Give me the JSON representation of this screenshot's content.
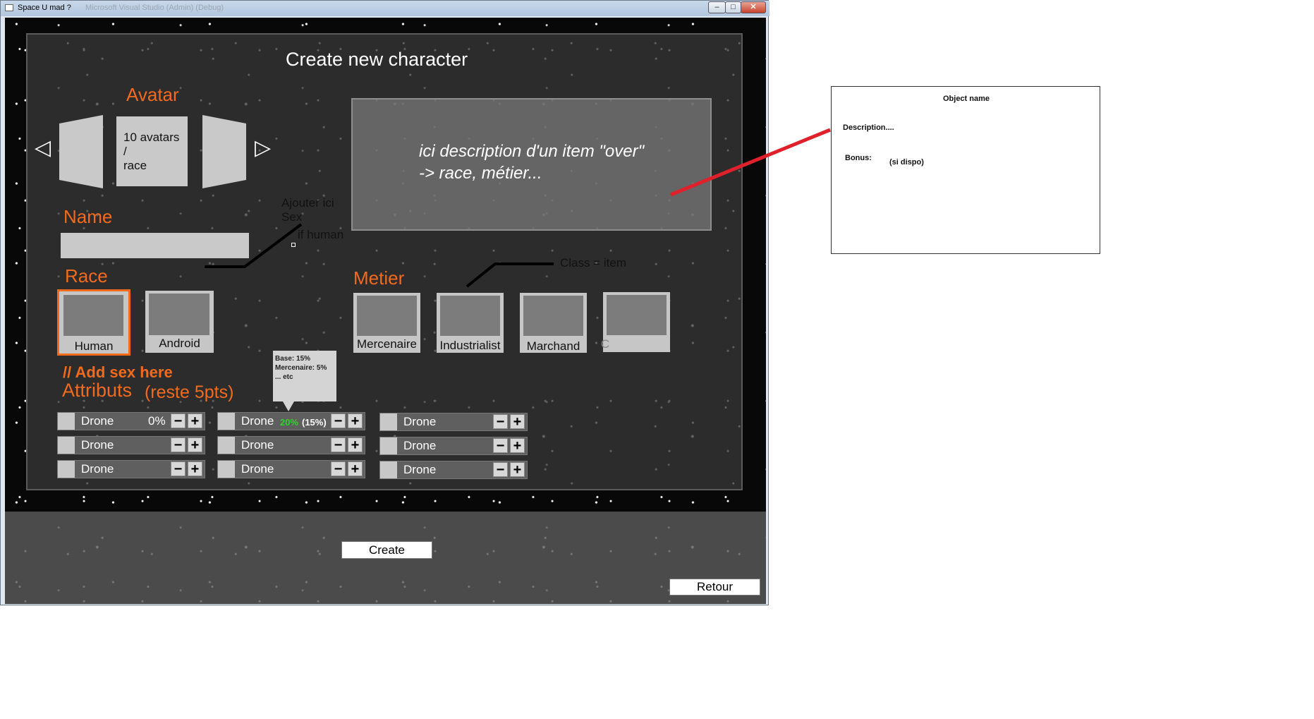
{
  "window": {
    "title": "Space U mad ?",
    "title_ghost": "Microsoft Visual Studio (Admin) (Debug)",
    "controls": [
      "–",
      "□",
      "✕"
    ]
  },
  "screen": {
    "heading": "Create new character",
    "avatar": {
      "label": "Avatar",
      "center_text_1": "10 avatars",
      "center_text_2": "/",
      "center_text_3": "race",
      "prev": "◁",
      "next": "▷"
    },
    "description": {
      "line1": "ici description d'un item \"over\"",
      "line2": "-> race, métier..."
    },
    "name": {
      "label": "Name",
      "value": ""
    },
    "notes": {
      "sex_note_1": "Ajouter ici",
      "sex_note_2": "Sex",
      "sex_note_3": "if human",
      "class_note": "Class = item",
      "add_sex": "// Add sex here"
    },
    "race": {
      "label": "Race",
      "options": [
        "Human",
        "Android"
      ],
      "selected": "Human"
    },
    "metier": {
      "label": "Metier",
      "options": [
        "Mercenaire",
        "Industrialist",
        "Marchand",
        "C"
      ]
    },
    "attributes": {
      "label": "Attributs",
      "remaining": "(reste 5pts)",
      "col1": [
        {
          "name": "Drone",
          "value": "0%"
        },
        {
          "name": "Drone",
          "value": ""
        },
        {
          "name": "Drone",
          "value": ""
        }
      ],
      "col2": [
        {
          "name": "Drone",
          "value": "20%",
          "bonus": "(15%)"
        },
        {
          "name": "Drone",
          "value": ""
        },
        {
          "name": "Drone",
          "value": ""
        }
      ],
      "col3": [
        {
          "name": "Drone",
          "value": ""
        },
        {
          "name": "Drone",
          "value": ""
        },
        {
          "name": "Drone",
          "value": ""
        }
      ],
      "minus": "−",
      "plus": "+"
    },
    "tooltip": {
      "line1": "Base: 15%",
      "line2": "Mercenaire: 5%",
      "line3": "... etc"
    },
    "create_button": "Create",
    "back_button": "Retour"
  },
  "mockup": {
    "title": "Object name",
    "description": "Description....",
    "bonus_label": "Bonus:",
    "bonus_value": "(si dispo)"
  },
  "colors": {
    "accent": "#f26b1d",
    "annotation_line": "#e0202a",
    "highlight_green": "#2bd62b"
  }
}
